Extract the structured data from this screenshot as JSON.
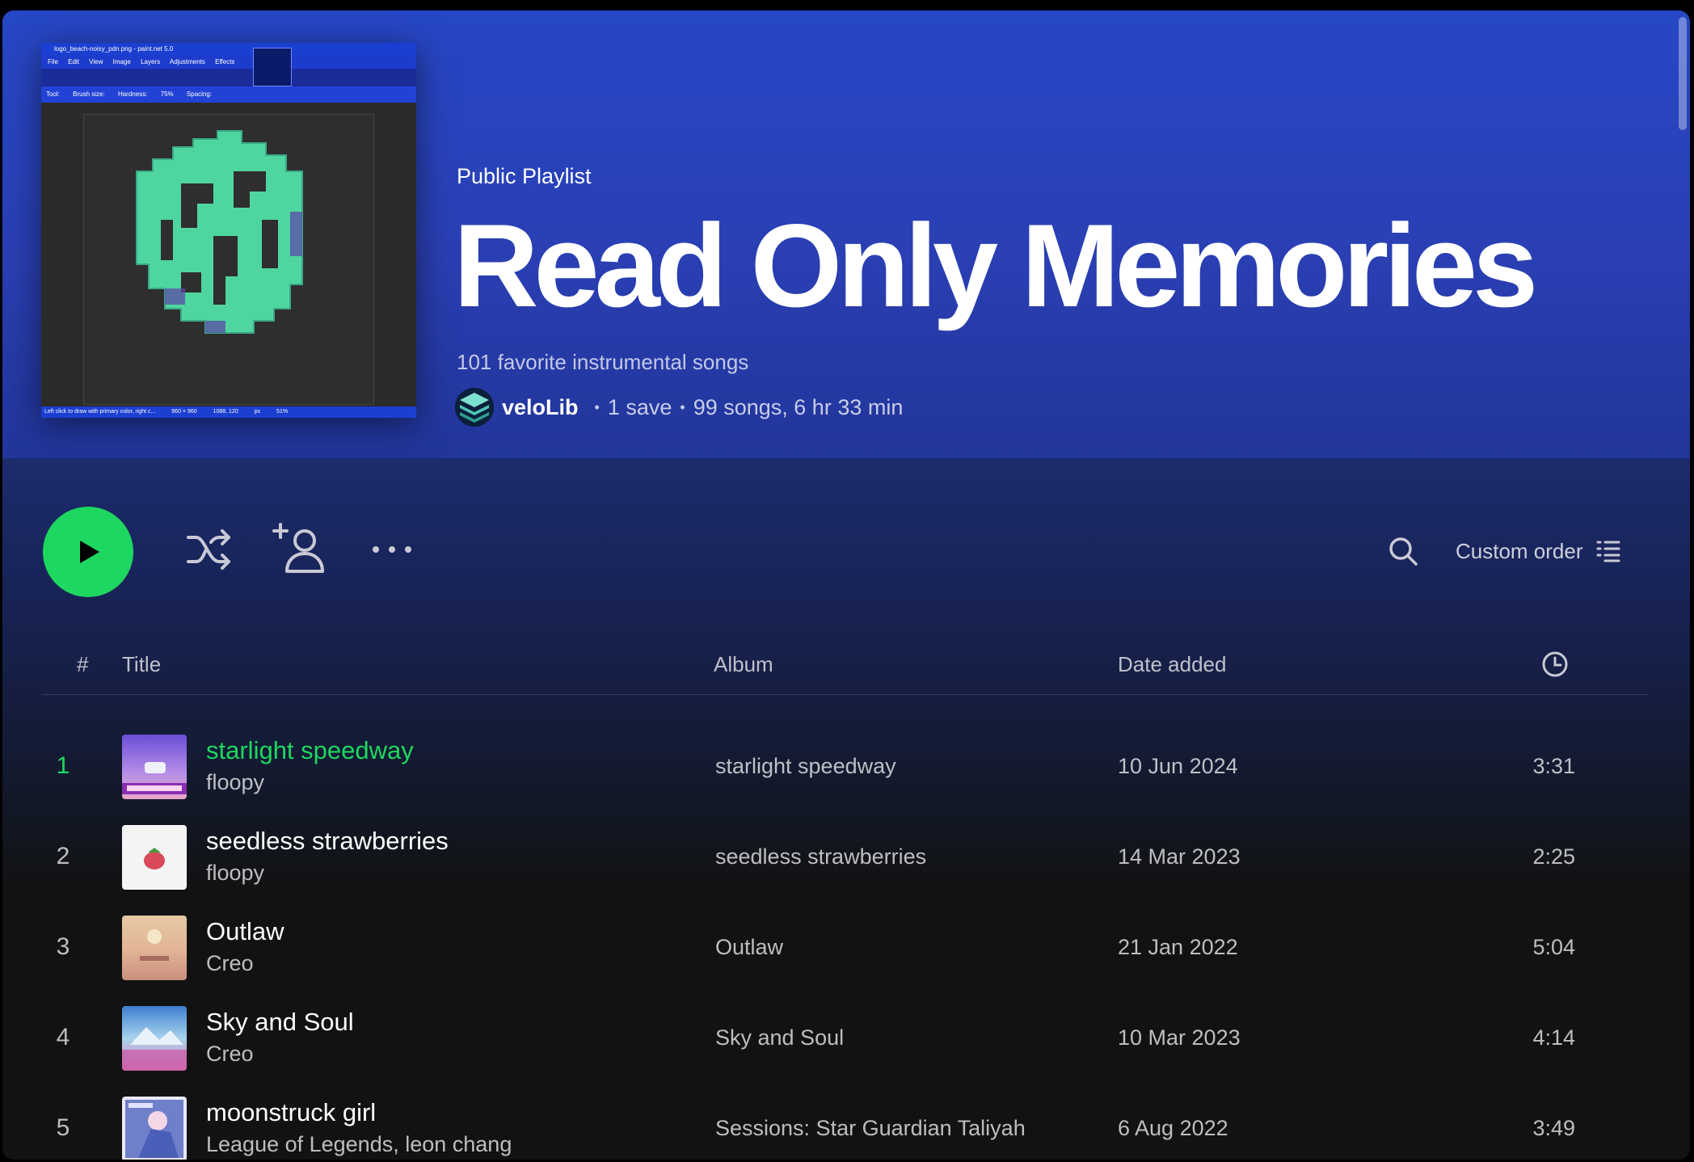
{
  "header": {
    "type_label": "Public Playlist",
    "title": "Read Only Memories",
    "description": "101 favorite instrumental songs",
    "owner": "veloLib",
    "saves": "1 save",
    "stats": "99 songs, 6 hr 33 min"
  },
  "cover": {
    "window_title": "logo_beach-noisy_pdn.png - paint.net 5.0",
    "menu": [
      "File",
      "Edit",
      "View",
      "Image",
      "Layers",
      "Adjustments",
      "Effects"
    ],
    "toolbar_labels": [
      "Tool:",
      "Brush size:",
      "Hardness:",
      "75%",
      "Spacing:"
    ],
    "status": [
      "Left click to draw with primary color, right c...",
      "960 × 960",
      "1088, 120",
      "px",
      "51%"
    ]
  },
  "actions": {
    "play": "play-icon",
    "shuffle": "shuffle-icon",
    "add_user": "add-user-icon",
    "more": "more-icon",
    "search": "search-icon",
    "sort_label": "Custom order",
    "sort_icon": "list-icon"
  },
  "table": {
    "columns": {
      "number": "#",
      "title": "Title",
      "album": "Album",
      "date_added": "Date added",
      "duration_icon": "clock-icon"
    },
    "rows": [
      {
        "num": "1",
        "title": "starlight speedway",
        "artist": "floopy",
        "album": "starlight speedway",
        "date": "10 Jun 2024",
        "duration": "3:31"
      },
      {
        "num": "2",
        "title": "seedless strawberries",
        "artist": "floopy",
        "album": "seedless strawberries",
        "date": "14 Mar 2023",
        "duration": "2:25"
      },
      {
        "num": "3",
        "title": "Outlaw",
        "artist": "Creo",
        "album": "Outlaw",
        "date": "21 Jan 2022",
        "duration": "5:04"
      },
      {
        "num": "4",
        "title": "Sky and Soul",
        "artist": "Creo",
        "album": "Sky and Soul",
        "date": "10 Mar 2023",
        "duration": "4:14"
      },
      {
        "num": "5",
        "title": "moonstruck girl",
        "artist": "League of Legends, leon chang",
        "album": "Sessions: Star Guardian Taliyah",
        "date": "6 Aug 2022",
        "duration": "3:49"
      }
    ]
  },
  "colors": {
    "accent": "#1ed760",
    "hero_blue": "#2647c6",
    "background": "#121212"
  }
}
